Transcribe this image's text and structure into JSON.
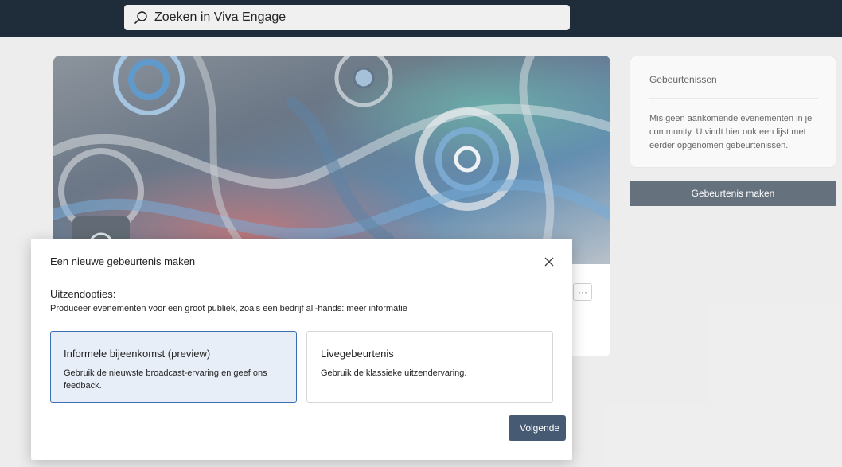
{
  "topbar": {
    "search_placeholder": "Zoeken in Viva Engage",
    "search_icon": "search-icon"
  },
  "hero": {
    "more_label": "···"
  },
  "events": {
    "title": "Gebeurtenissen",
    "text": "Mis geen aankomende evenementen in je community. U vindt hier ook een lijst met eerder opgenomen gebeurtenissen.",
    "create_button": "Gebeurtenis maken"
  },
  "dialog": {
    "title": "Een nieuwe gebeurtenis maken",
    "close_icon": "close-icon",
    "subhead": "Uitzendopties:",
    "description": "Produceer evenementen voor een groot publiek, zoals een bedrijf all-hands: meer informatie",
    "options": [
      {
        "name": "Informele bijeenkomst (preview)",
        "description": "Gebruik de nieuwste broadcast-ervaring en geef ons feedback.",
        "selected": true
      },
      {
        "name": "Livegebeurtenis",
        "description": "Gebruik de klassieke uitzendervaring.",
        "selected": false
      }
    ],
    "next_button": "Volgende"
  },
  "colors": {
    "topbar": "#1f2c3a",
    "primary_button": "#243447",
    "next_button": "#465b73",
    "selected_border": "#3a6fb3",
    "selected_bg": "#e8eef7"
  }
}
